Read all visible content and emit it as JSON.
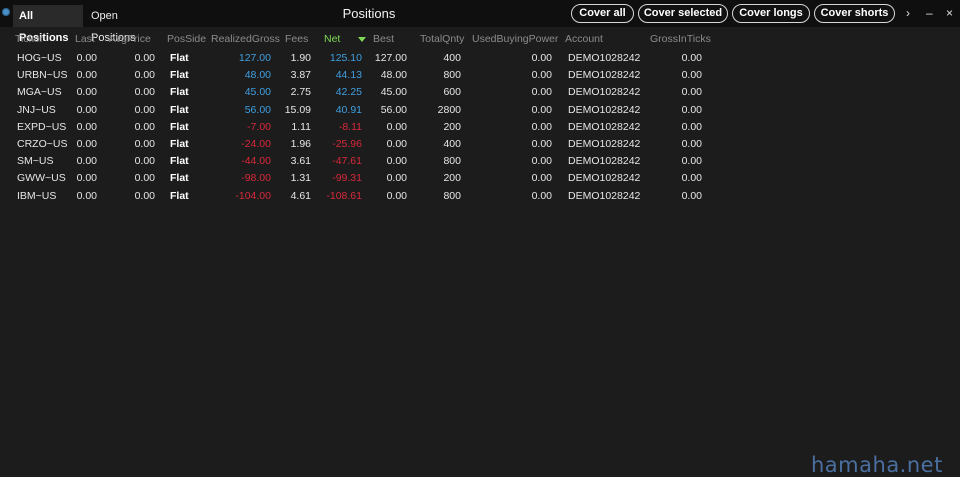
{
  "tabs": {
    "all_positions": "All Positions",
    "open_positions": "Open Positions"
  },
  "window": {
    "title": "Positions"
  },
  "toolbar": {
    "cover_all": "Cover all",
    "cover_selected": "Cover selected",
    "cover_longs": "Cover longs",
    "cover_shorts": "Cover shorts",
    "more": "›",
    "minimize": "–",
    "close": "×"
  },
  "columns": {
    "ticker": "Ticker",
    "last": "Last",
    "avg_price": "AvgPrice",
    "pos_side": "PosSide",
    "realized_gross": "RealizedGross",
    "fees": "Fees",
    "net": "Net",
    "best": "Best",
    "total_qnty": "TotalQnty",
    "used_buying_power": "UsedBuyingPower",
    "account": "Account",
    "gross_in_ticks": "GrossInTicks"
  },
  "rows": [
    {
      "ticker": "HOG~US",
      "last": "0.00",
      "avg_price": "0.00",
      "pos_side": "Flat",
      "realized_gross": "127.00",
      "fees": "1.90",
      "net": "125.10",
      "best": "127.00",
      "total_qnty": "400",
      "used_buying_power": "0.00",
      "account": "DEMO1028242",
      "gross_in_ticks": "0.00",
      "sign": "pos"
    },
    {
      "ticker": "URBN~US",
      "last": "0.00",
      "avg_price": "0.00",
      "pos_side": "Flat",
      "realized_gross": "48.00",
      "fees": "3.87",
      "net": "44.13",
      "best": "48.00",
      "total_qnty": "800",
      "used_buying_power": "0.00",
      "account": "DEMO1028242",
      "gross_in_ticks": "0.00",
      "sign": "pos"
    },
    {
      "ticker": "MGA~US",
      "last": "0.00",
      "avg_price": "0.00",
      "pos_side": "Flat",
      "realized_gross": "45.00",
      "fees": "2.75",
      "net": "42.25",
      "best": "45.00",
      "total_qnty": "600",
      "used_buying_power": "0.00",
      "account": "DEMO1028242",
      "gross_in_ticks": "0.00",
      "sign": "pos"
    },
    {
      "ticker": "JNJ~US",
      "last": "0.00",
      "avg_price": "0.00",
      "pos_side": "Flat",
      "realized_gross": "56.00",
      "fees": "15.09",
      "net": "40.91",
      "best": "56.00",
      "total_qnty": "2800",
      "used_buying_power": "0.00",
      "account": "DEMO1028242",
      "gross_in_ticks": "0.00",
      "sign": "pos"
    },
    {
      "ticker": "EXPD~US",
      "last": "0.00",
      "avg_price": "0.00",
      "pos_side": "Flat",
      "realized_gross": "-7.00",
      "fees": "1.11",
      "net": "-8.11",
      "best": "0.00",
      "total_qnty": "200",
      "used_buying_power": "0.00",
      "account": "DEMO1028242",
      "gross_in_ticks": "0.00",
      "sign": "neg"
    },
    {
      "ticker": "CRZO~US",
      "last": "0.00",
      "avg_price": "0.00",
      "pos_side": "Flat",
      "realized_gross": "-24.00",
      "fees": "1.96",
      "net": "-25.96",
      "best": "0.00",
      "total_qnty": "400",
      "used_buying_power": "0.00",
      "account": "DEMO1028242",
      "gross_in_ticks": "0.00",
      "sign": "neg"
    },
    {
      "ticker": "SM~US",
      "last": "0.00",
      "avg_price": "0.00",
      "pos_side": "Flat",
      "realized_gross": "-44.00",
      "fees": "3.61",
      "net": "-47.61",
      "best": "0.00",
      "total_qnty": "800",
      "used_buying_power": "0.00",
      "account": "DEMO1028242",
      "gross_in_ticks": "0.00",
      "sign": "neg"
    },
    {
      "ticker": "GWW~US",
      "last": "0.00",
      "avg_price": "0.00",
      "pos_side": "Flat",
      "realized_gross": "-98.00",
      "fees": "1.31",
      "net": "-99.31",
      "best": "0.00",
      "total_qnty": "200",
      "used_buying_power": "0.00",
      "account": "DEMO1028242",
      "gross_in_ticks": "0.00",
      "sign": "neg"
    },
    {
      "ticker": "IBM~US",
      "last": "0.00",
      "avg_price": "0.00",
      "pos_side": "Flat",
      "realized_gross": "-104.00",
      "fees": "4.61",
      "net": "-108.61",
      "best": "0.00",
      "total_qnty": "800",
      "used_buying_power": "0.00",
      "account": "DEMO1028242",
      "gross_in_ticks": "0.00",
      "sign": "neg"
    }
  ],
  "watermark": "hamaha.net",
  "colors": {
    "positive": "#3f9fe0",
    "negative": "#d8283b",
    "sorted_column": "#7ed957",
    "background": "#1c1c1c"
  }
}
